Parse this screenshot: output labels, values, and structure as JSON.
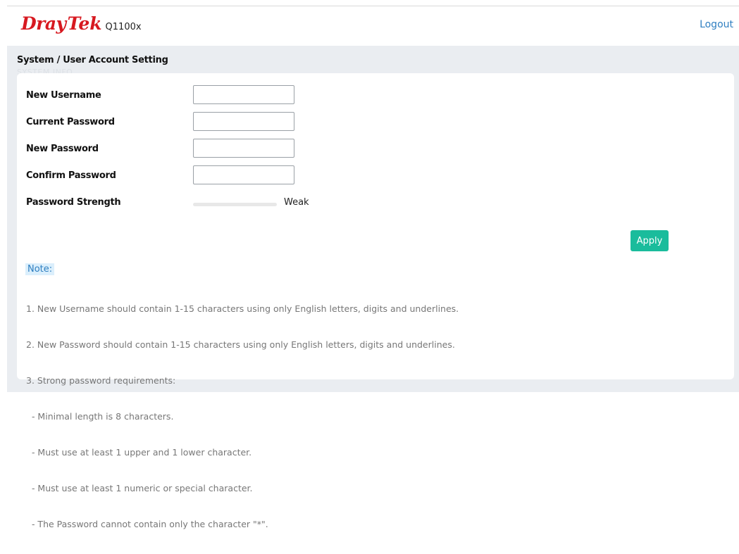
{
  "header": {
    "logo_brand_dray": "Dray",
    "logo_brand_tek": "Tek",
    "model": "Q1100x",
    "logout_label": "Logout"
  },
  "breadcrumb": "System / User Account Setting",
  "ghost_text": "SYSTEM INFO",
  "form": {
    "fields": [
      {
        "label": "New Username",
        "value": "",
        "type": "text"
      },
      {
        "label": "Current Password",
        "value": "",
        "type": "password"
      },
      {
        "label": "New Password",
        "value": "",
        "type": "password"
      },
      {
        "label": "Confirm Password",
        "value": "",
        "type": "password"
      }
    ],
    "strength_label": "Password Strength",
    "strength_value": "Weak",
    "strength_level": 0,
    "apply_label": "Apply"
  },
  "note": {
    "title": "Note:",
    "lines": [
      "1. New Username should contain 1-15 characters using only English letters, digits and underlines.",
      "2. New Password should contain 1-15 characters using only English letters, digits and underlines.",
      "3. Strong password requirements:",
      "  - Minimal length is 8 characters.",
      "  - Must use at least 1 upper and 1 lower character.",
      "  - Must use at least 1 numeric or special character.",
      "  - The Password cannot contain only the character \"*\"."
    ]
  },
  "colors": {
    "brand": "#d71920",
    "link": "#2f7fc1",
    "apply": "#1abc9c",
    "background": "#eaedf1"
  }
}
